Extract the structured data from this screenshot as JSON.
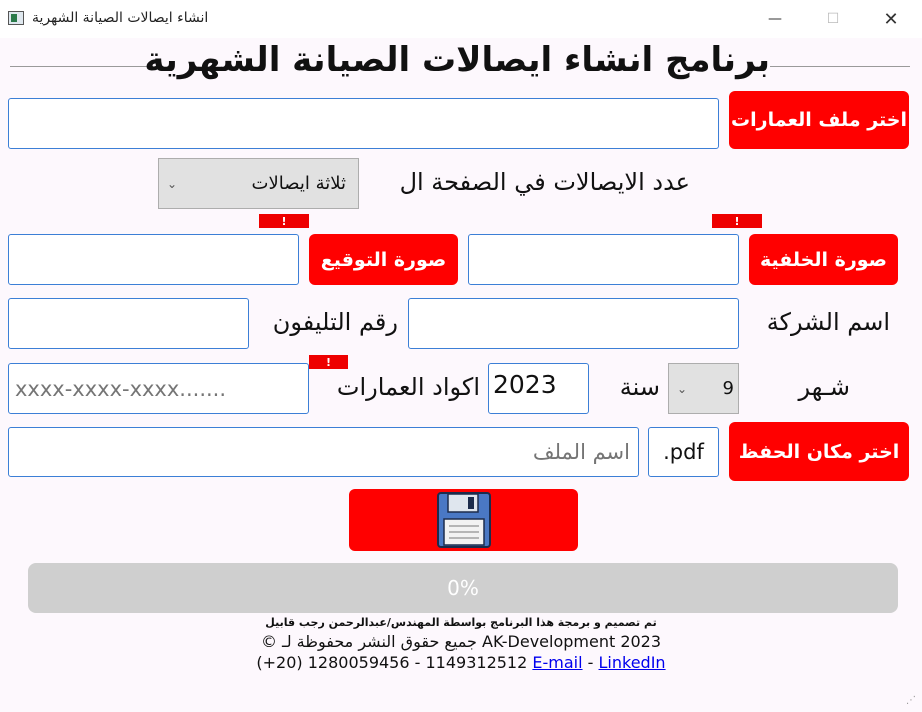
{
  "window": {
    "title": "انشاء ايصالات الصيانة الشهرية",
    "controls": {
      "minimize": "—",
      "maximize": "☐",
      "close": "✕"
    }
  },
  "heading": "برنامج انشاء ايصالات الصيانة الشهرية",
  "buildings_file": {
    "button": "اختر ملف العمارات",
    "value": ""
  },
  "receipts_per_page": {
    "label": "عدد الايصالات في الصفحة ال",
    "selected": "ثلاثة ايصالات"
  },
  "background_image": {
    "button": "صورة الخلفية",
    "value": "",
    "warning": "!"
  },
  "signature_image": {
    "button": "صورة التوقيع",
    "value": "",
    "warning": "!"
  },
  "company_name": {
    "label": "اسم الشركة",
    "value": ""
  },
  "phone_number": {
    "label": "رقم التليفون",
    "value": ""
  },
  "month": {
    "label": "شـهر",
    "selected": "9"
  },
  "year": {
    "label": "سنة",
    "value": "2023"
  },
  "building_codes": {
    "label": "اكواد العمارات",
    "placeholder": "xxxx-xxxx-xxxx.......",
    "warning": "!"
  },
  "save_location": {
    "button": "اختر مكان الحفظ",
    "extension": ".pdf",
    "filename_placeholder": "اسم الملف"
  },
  "save_button": {
    "icon": "floppy-disk-icon"
  },
  "progress": {
    "value": 0,
    "text": "0%"
  },
  "footer": {
    "credit": "تم تصميم و برمجة هذا البرنامج بواسطة المهندس/عبدالرحمن رجب قابيل",
    "copyright": "© جميع حقوق النشر محفوظة لـ AK-Development 2023",
    "phones": "(+20) 1280059456 - 1149312512",
    "sep": "-",
    "email": "E-mail",
    "linkedin": "LinkedIn"
  },
  "colors": {
    "accent": "#ff0000",
    "field_border": "#3c7fd6",
    "background": "#fdf8fd"
  }
}
